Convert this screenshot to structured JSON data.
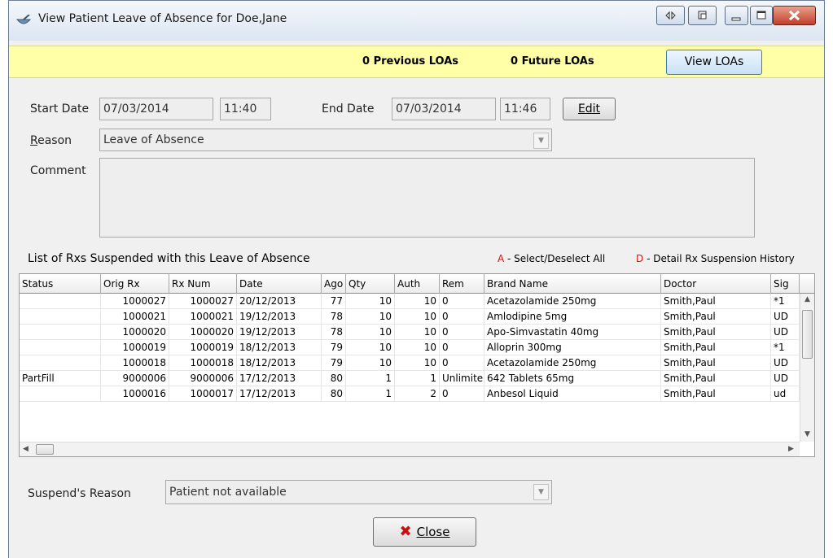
{
  "window": {
    "title": "View Patient Leave of Absence for Doe,Jane",
    "controls": {
      "dock": "◁▷",
      "float": "⧉",
      "minimize": "▁",
      "maximize": "▢",
      "close": "✕"
    }
  },
  "loa_bar": {
    "previous": "0 Previous LOAs",
    "future": "0 Future LOAs",
    "view_button": "View LOAs"
  },
  "form": {
    "start_label": "Start Date",
    "start_date": "07/03/2014",
    "start_time": "11:40",
    "end_label": "End Date",
    "end_date": "07/03/2014",
    "end_time": "11:46",
    "edit_button": "Edit",
    "reason_label": "Reason",
    "reason_value": "Leave of Absence",
    "comment_label": "Comment",
    "comment_value": ""
  },
  "list": {
    "title": "List of Rxs Suspended with this Leave of Absence",
    "legend_a_key": "A",
    "legend_a_text": " - Select/Deselect All",
    "legend_d_key": "D",
    "legend_d_text": " - Detail Rx Suspension History",
    "columns": [
      "Status",
      "Orig Rx",
      "Rx Num",
      "Date",
      "Ago",
      "Qty",
      "Auth",
      "Rem",
      "Brand Name",
      "Doctor",
      "Sig"
    ],
    "rows": [
      [
        "",
        "1000027",
        "1000027",
        "20/12/2013",
        "77",
        "10",
        "10",
        "0",
        "Acetazolamide 250mg",
        "Smith,Paul",
        "*1"
      ],
      [
        "",
        "1000021",
        "1000021",
        "19/12/2013",
        "78",
        "10",
        "10",
        "0",
        "Amlodipine 5mg",
        "Smith,Paul",
        "UD"
      ],
      [
        "",
        "1000020",
        "1000020",
        "19/12/2013",
        "78",
        "10",
        "10",
        "0",
        "Apo-Simvastatin 40mg",
        "Smith,Paul",
        "UD"
      ],
      [
        "",
        "1000019",
        "1000019",
        "18/12/2013",
        "79",
        "10",
        "10",
        "0",
        "Alloprin 300mg",
        "Smith,Paul",
        "*1"
      ],
      [
        "",
        "1000018",
        "1000018",
        "18/12/2013",
        "79",
        "10",
        "10",
        "0",
        "Acetazolamide 250mg",
        "Smith,Paul",
        "UD"
      ],
      [
        "PartFill",
        "9000006",
        "9000006",
        "17/12/2013",
        "80",
        "1",
        "1",
        "Unlimite",
        "642 Tablets 65mg",
        "Smith,Paul",
        "UD"
      ],
      [
        "",
        "1000016",
        "1000017",
        "17/12/2013",
        "80",
        "1",
        "2",
        "0",
        "Anbesol Liquid",
        "Smith,Paul",
        "ud"
      ]
    ]
  },
  "suspend": {
    "label": "Suspend's Reason",
    "value": "Patient not available"
  },
  "close_button": "Close"
}
